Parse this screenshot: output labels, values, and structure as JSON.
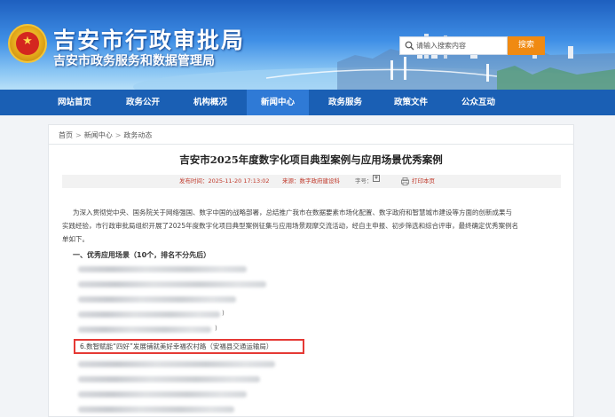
{
  "header": {
    "title": "吉安市行政审批局",
    "subtitle": "吉安市政务服务和数据管理局",
    "search": {
      "placeholder": "请输入搜索内容",
      "button_label": "搜索"
    }
  },
  "nav": {
    "items": [
      {
        "label": "网站首页"
      },
      {
        "label": "政务公开"
      },
      {
        "label": "机构概况"
      },
      {
        "label": "新闻中心"
      },
      {
        "label": "政务服务"
      },
      {
        "label": "政策文件"
      },
      {
        "label": "公众互动"
      }
    ],
    "active": "新闻中心"
  },
  "breadcrumb": {
    "items": [
      "首页",
      "新闻中心",
      "政务动态"
    ],
    "separator": ">"
  },
  "article": {
    "title": "吉安市2025年度数字化项目典型案例与应用场景优秀案例",
    "meta": {
      "publish_label": "发布时间：2025-11-20 17:13:02",
      "source_label": "来源：数字政府建设科",
      "font_label": "字号：",
      "font_plus": "+",
      "font_minus": "-",
      "print_label": "打印本页"
    },
    "intro_line1": "为深入贯彻党中央、国务院关于网络强国、数字中国的战略部署，总结推广我市在数据要素市场化配置、数字政府和智慧城市建设等方面的创新成果与",
    "intro_line2": "实践经验，市行政审批局组织开展了2025年度数字化项目典型案例征集与应用场景观摩交流活动，经自主申报、初步筛选和综合评审，最终确定优秀案例名",
    "intro_line3": "单如下。",
    "section_heading": "一、优秀应用场景（10个，排名不分先后）",
    "highlighted_item": "6.数智赋能“四好”发展铺就美好幸福农村路（安福县交通运输局）",
    "paren_marks": [
      ")",
      ")"
    ]
  },
  "colors": {
    "nav_bg": "#1a5fb4",
    "search_button": "#f08a12",
    "highlight_border": "#e53935",
    "meta_text": "#c0392b"
  }
}
